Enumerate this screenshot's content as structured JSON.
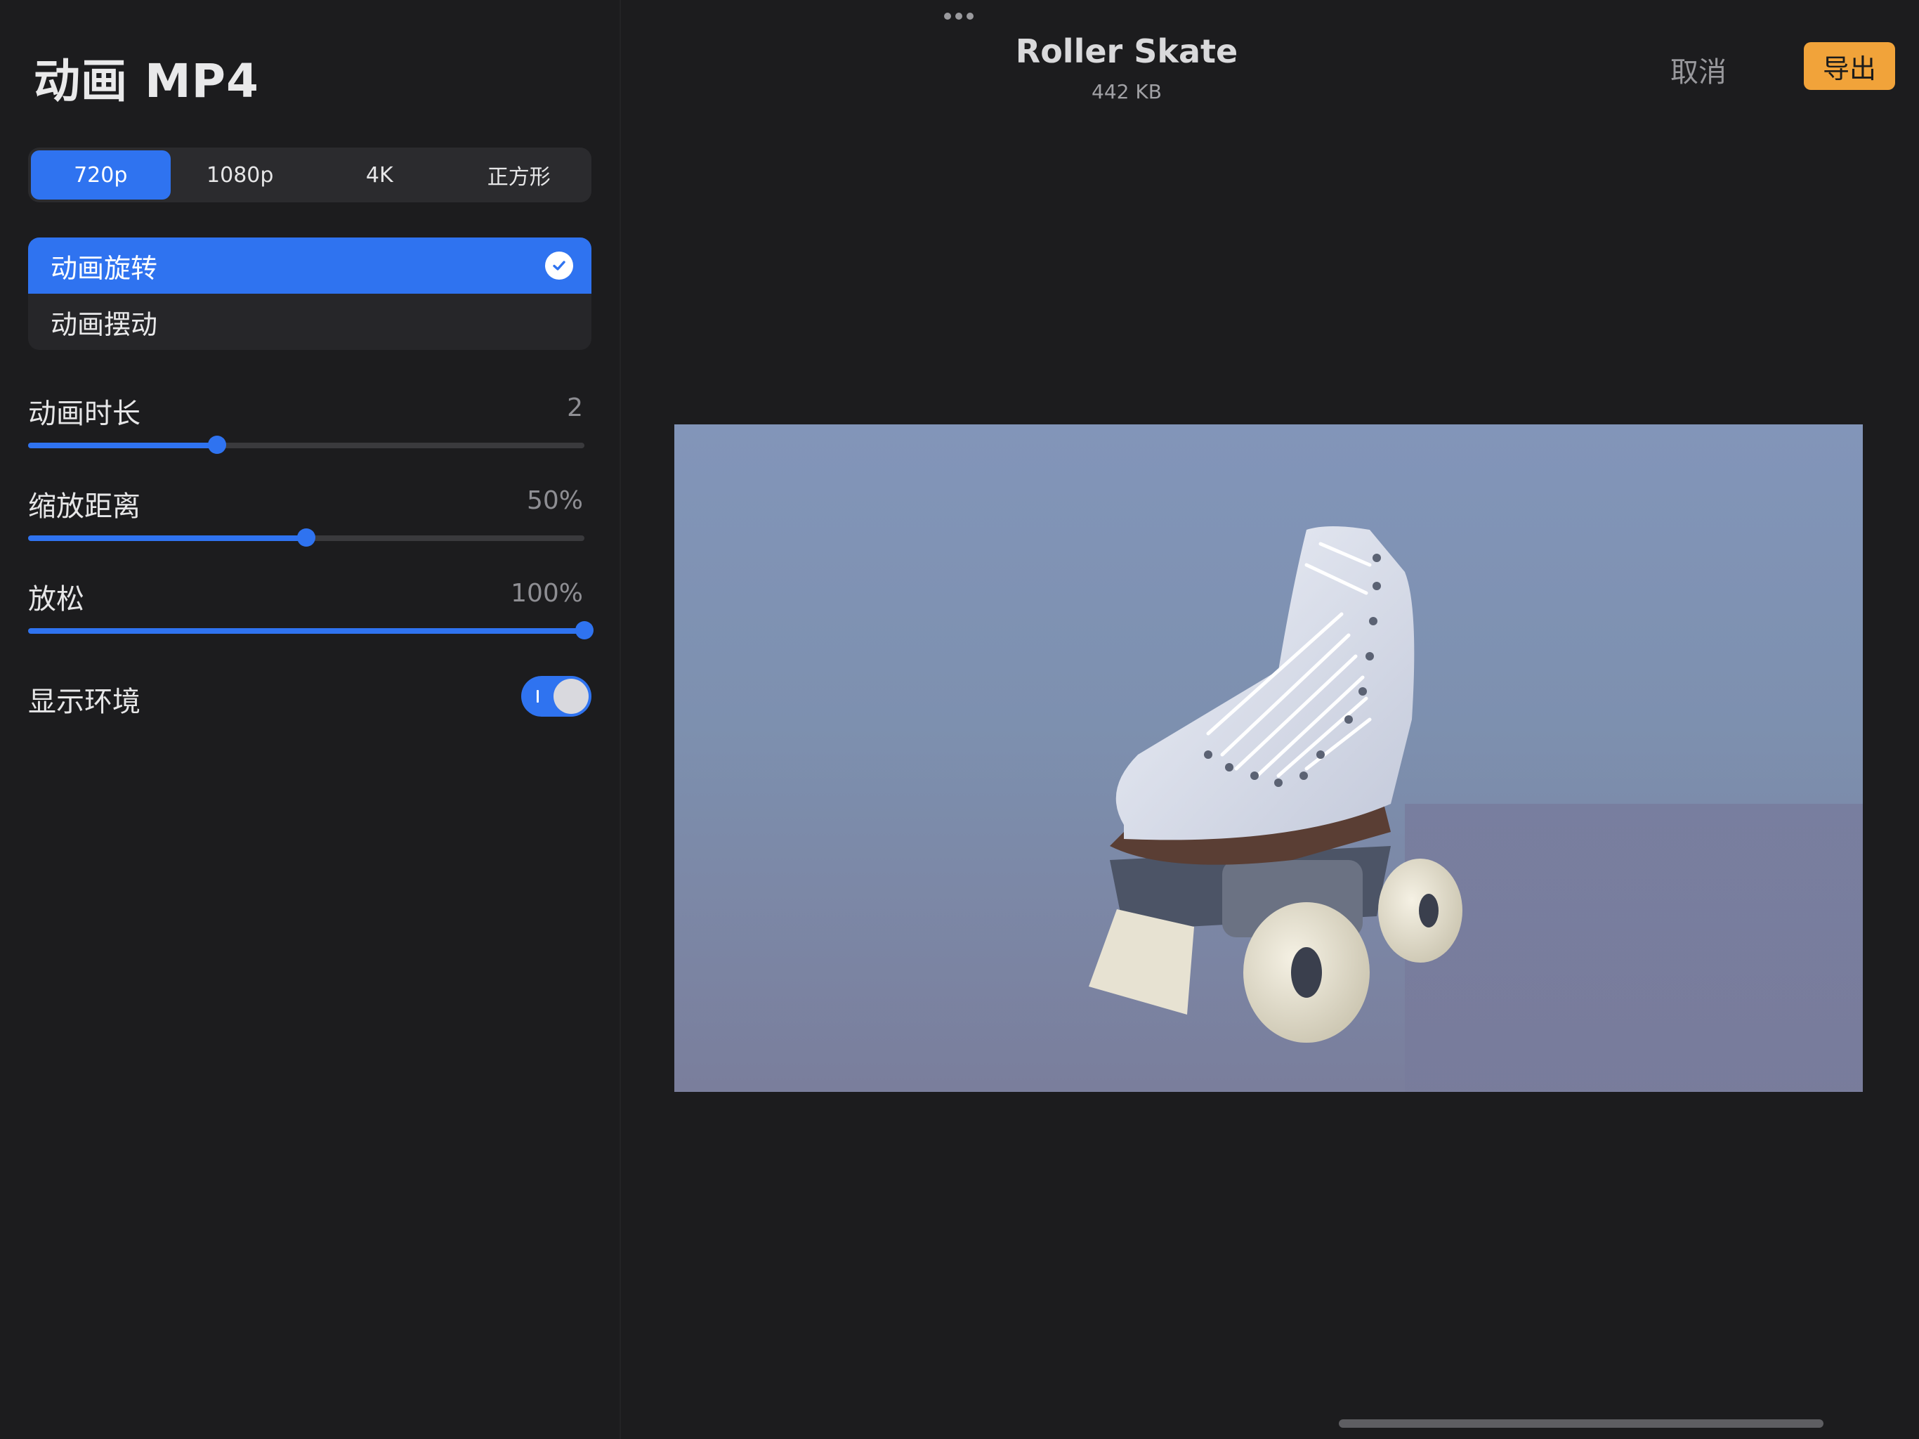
{
  "sidebar": {
    "title": "动画 MP4",
    "resolution_tabs": [
      {
        "label": "720p",
        "active": true
      },
      {
        "label": "1080p",
        "active": false
      },
      {
        "label": "4K",
        "active": false
      },
      {
        "label": "正方形",
        "active": false
      }
    ],
    "animation_types": [
      {
        "label": "动画旋转",
        "selected": true
      },
      {
        "label": "动画摆动",
        "selected": false
      }
    ],
    "settings": {
      "duration": {
        "label": "动画时长",
        "value": "2",
        "fraction": 0.34
      },
      "zoom": {
        "label": "缩放距离",
        "value": "50%",
        "fraction": 0.5
      },
      "ease": {
        "label": "放松",
        "value": "100%",
        "fraction": 1.0
      },
      "environment": {
        "label": "显示环境",
        "on": true
      }
    }
  },
  "header": {
    "doc_title": "Roller Skate",
    "doc_size": "442 KB",
    "cancel_label": "取消",
    "export_label": "导出"
  },
  "preview": {
    "subject": "roller-skate-3d-model"
  },
  "colors": {
    "accent": "#2f73f0",
    "export": "#f1a33a",
    "background": "#1c1c1e"
  }
}
